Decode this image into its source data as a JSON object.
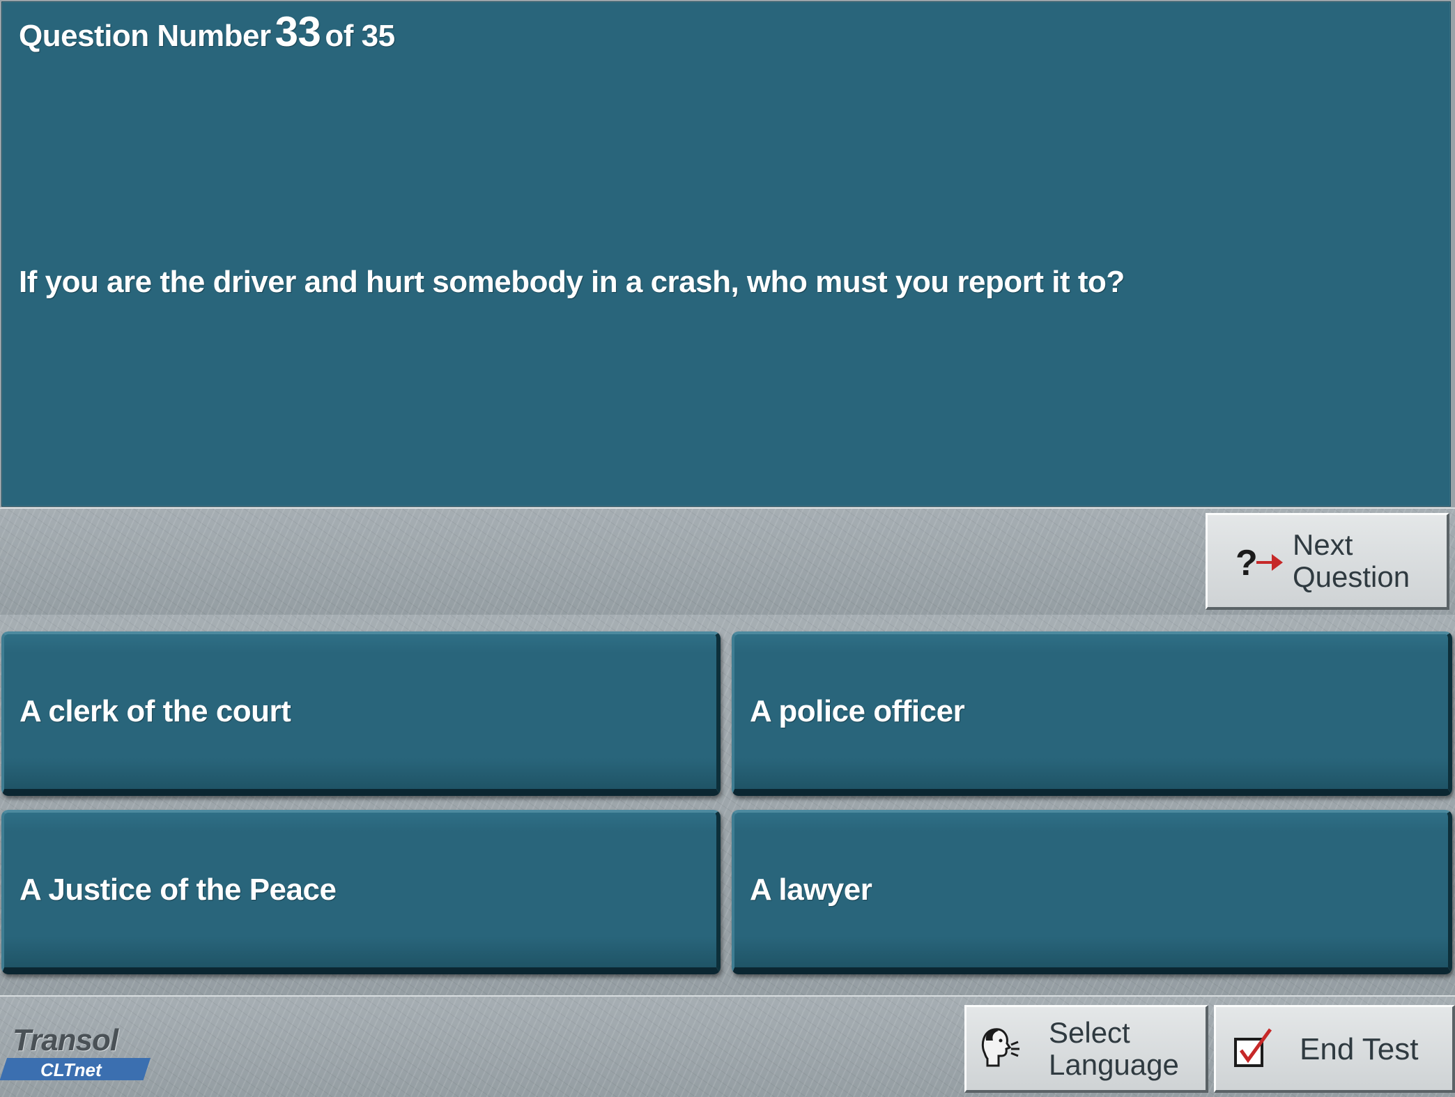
{
  "question": {
    "prefix": "Question Number",
    "number": "33",
    "suffix": "of 35",
    "text": "If you are the driver and hurt somebody in a crash, who must you report it to?"
  },
  "navigation": {
    "next_line1": "Next",
    "next_line2": "Question",
    "next_icon": "question-arrow-icon"
  },
  "answers": [
    {
      "text": "A clerk of the court"
    },
    {
      "text": "A police officer"
    },
    {
      "text": "A Justice of the Peace"
    },
    {
      "text": "A lawyer"
    }
  ],
  "footer": {
    "brand_name": "Transol",
    "brand_sub": "CLTnet",
    "select_language_line1": "Select",
    "select_language_line2": "Language",
    "select_language_icon": "speaking-head-icon",
    "end_test_label": "End Test",
    "end_test_icon": "checkbox-check-icon"
  },
  "colors": {
    "panel": "#29657b",
    "button_face": "#d8dcde",
    "arrow": "#c62828",
    "logo_blue": "#3b6fb0"
  }
}
